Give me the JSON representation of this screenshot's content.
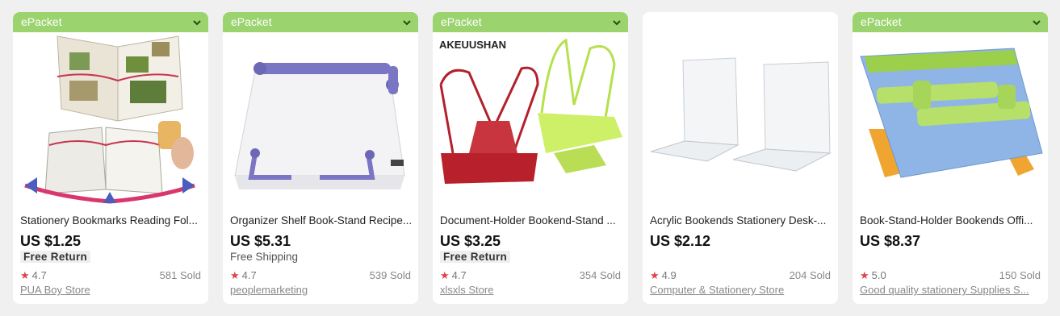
{
  "colors": {
    "shipping_bar": "#9bd36e",
    "star": "#e0424b"
  },
  "products": [
    {
      "shipping": "ePacket",
      "image_icon": "reading-bookmark-icon",
      "title": "Stationery Bookmarks Reading Fol...",
      "price": "US $1.25",
      "promo": "Free Return",
      "rating": "4.7",
      "sold": "581 Sold",
      "store": "PUA Boy Store"
    },
    {
      "shipping": "ePacket",
      "image_icon": "book-stand-icon",
      "title": "Organizer Shelf Book-Stand Recipe...",
      "price": "US $5.31",
      "promo": "Free Shipping",
      "rating": "4.7",
      "sold": "539 Sold",
      "store": "peoplemarketing"
    },
    {
      "shipping": "ePacket",
      "image_icon": "document-holder-icon",
      "image_text": "AKEUUSHAN",
      "title": "Document-Holder Bookend-Stand ...",
      "price": "US $3.25",
      "promo": "Free Return",
      "rating": "4.7",
      "sold": "354 Sold",
      "store": "xlsxls Store"
    },
    {
      "shipping": "",
      "image_icon": "acrylic-bookends-icon",
      "title": "Acrylic Bookends Stationery Desk-...",
      "price": "US $2.12",
      "promo": "",
      "rating": "4.9",
      "sold": "204 Sold",
      "store": "Computer & Stationery Store"
    },
    {
      "shipping": "ePacket",
      "image_icon": "book-stand-holder-icon",
      "title": "Book-Stand-Holder Bookends Offi...",
      "price": "US $8.37",
      "promo": "",
      "rating": "5.0",
      "sold": "150 Sold",
      "store": "Good quality stationery Supplies S..."
    }
  ]
}
